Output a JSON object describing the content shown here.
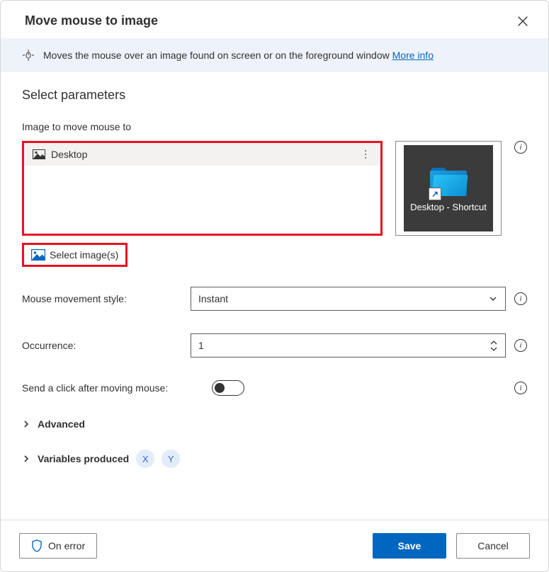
{
  "title": "Move mouse to image",
  "banner": {
    "text": "Moves the mouse over an image found on screen or on the foreground window ",
    "more": "More info"
  },
  "section_title": "Select parameters",
  "labels": {
    "image_to_move": "Image to move mouse to",
    "select_images": "Select image(s)",
    "movement_style": "Mouse movement style:",
    "occurrence": "Occurrence:",
    "send_click": "Send a click after moving mouse:",
    "advanced": "Advanced",
    "variables_produced": "Variables produced",
    "on_error": "On error",
    "save": "Save",
    "cancel": "Cancel"
  },
  "image_list": {
    "items": [
      {
        "name": "Desktop"
      }
    ]
  },
  "preview": {
    "caption": "Desktop - Shortcut"
  },
  "movement_style_value": "Instant",
  "occurrence_value": "1",
  "send_click_value": false,
  "variables": [
    "X",
    "Y"
  ]
}
